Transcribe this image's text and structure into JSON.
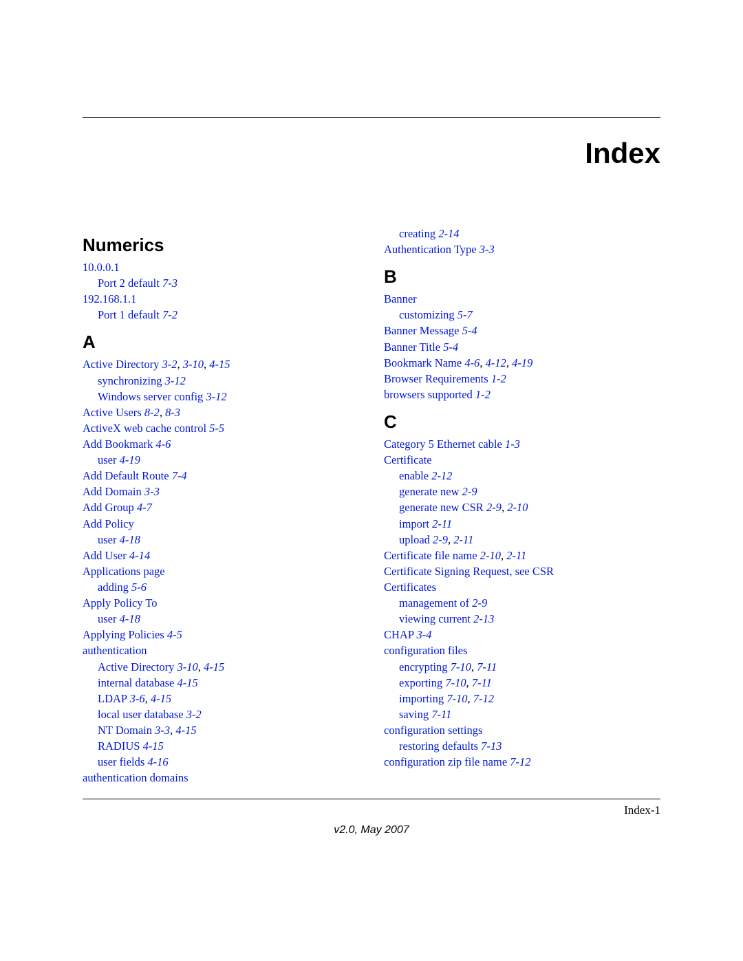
{
  "title": "Index",
  "page_number": "Index-1",
  "footer_version": "v2.0, May 2007",
  "left": {
    "sections": [
      {
        "heading": "Numerics",
        "items": [
          {
            "lvl": 1,
            "parts": [
              {
                "t": "10.0.0.1",
                "c": "link"
              }
            ]
          },
          {
            "lvl": 2,
            "parts": [
              {
                "t": "Port 2 default ",
                "c": "link"
              },
              {
                "t": "7-3",
                "c": "link ital"
              }
            ]
          },
          {
            "lvl": 1,
            "parts": [
              {
                "t": "192.168.1.1",
                "c": "link"
              }
            ]
          },
          {
            "lvl": 2,
            "parts": [
              {
                "t": "Port 1 default ",
                "c": "link"
              },
              {
                "t": "7-2",
                "c": "link ital"
              }
            ]
          }
        ]
      },
      {
        "heading": "A",
        "items": [
          {
            "lvl": 1,
            "parts": [
              {
                "t": "Active Directory ",
                "c": "link"
              },
              {
                "t": "3-2",
                "c": "link ital"
              },
              {
                "t": ", ",
                "c": "sep"
              },
              {
                "t": "3-10",
                "c": "link ital"
              },
              {
                "t": ", ",
                "c": "sep"
              },
              {
                "t": "4-15",
                "c": "link ital"
              }
            ]
          },
          {
            "lvl": 2,
            "parts": [
              {
                "t": "synchronizing ",
                "c": "link"
              },
              {
                "t": "3-12",
                "c": "link ital"
              }
            ]
          },
          {
            "lvl": 2,
            "parts": [
              {
                "t": "Windows server config ",
                "c": "link"
              },
              {
                "t": "3-12",
                "c": "link ital"
              }
            ]
          },
          {
            "lvl": 1,
            "parts": [
              {
                "t": "Active Users ",
                "c": "link"
              },
              {
                "t": "8-2",
                "c": "link ital"
              },
              {
                "t": ", ",
                "c": "sep"
              },
              {
                "t": "8-3",
                "c": "link ital"
              }
            ]
          },
          {
            "lvl": 1,
            "parts": [
              {
                "t": "ActiveX web cache control ",
                "c": "link"
              },
              {
                "t": "5-5",
                "c": "link ital"
              }
            ]
          },
          {
            "lvl": 1,
            "parts": [
              {
                "t": "Add Bookmark ",
                "c": "link"
              },
              {
                "t": "4-6",
                "c": "link ital"
              }
            ]
          },
          {
            "lvl": 2,
            "parts": [
              {
                "t": "user ",
                "c": "link"
              },
              {
                "t": "4-19",
                "c": "link ital"
              }
            ]
          },
          {
            "lvl": 1,
            "parts": [
              {
                "t": "Add Default Route ",
                "c": "link"
              },
              {
                "t": "7-4",
                "c": "link ital"
              }
            ]
          },
          {
            "lvl": 1,
            "parts": [
              {
                "t": "Add Domain ",
                "c": "link"
              },
              {
                "t": "3-3",
                "c": "link ital"
              }
            ]
          },
          {
            "lvl": 1,
            "parts": [
              {
                "t": "Add Group ",
                "c": "link"
              },
              {
                "t": "4-7",
                "c": "link ital"
              }
            ]
          },
          {
            "lvl": 1,
            "parts": [
              {
                "t": "Add Policy",
                "c": "link"
              }
            ]
          },
          {
            "lvl": 2,
            "parts": [
              {
                "t": "user ",
                "c": "link"
              },
              {
                "t": "4-18",
                "c": "link ital"
              }
            ]
          },
          {
            "lvl": 1,
            "parts": [
              {
                "t": "Add User ",
                "c": "link"
              },
              {
                "t": "4-14",
                "c": "link ital"
              }
            ]
          },
          {
            "lvl": 1,
            "parts": [
              {
                "t": "Applications page",
                "c": "link"
              }
            ]
          },
          {
            "lvl": 2,
            "parts": [
              {
                "t": "adding ",
                "c": "link"
              },
              {
                "t": "5-6",
                "c": "link ital"
              }
            ]
          },
          {
            "lvl": 1,
            "parts": [
              {
                "t": "Apply Policy To",
                "c": "link"
              }
            ]
          },
          {
            "lvl": 2,
            "parts": [
              {
                "t": "user ",
                "c": "link"
              },
              {
                "t": "4-18",
                "c": "link ital"
              }
            ]
          },
          {
            "lvl": 1,
            "parts": [
              {
                "t": "Applying Policies ",
                "c": "link"
              },
              {
                "t": "4-5",
                "c": "link ital"
              }
            ]
          },
          {
            "lvl": 1,
            "parts": [
              {
                "t": "authentication",
                "c": "link"
              }
            ]
          },
          {
            "lvl": 2,
            "parts": [
              {
                "t": "Active Directory ",
                "c": "link"
              },
              {
                "t": "3-10",
                "c": "link ital"
              },
              {
                "t": ", ",
                "c": "sep"
              },
              {
                "t": "4-15",
                "c": "link ital"
              }
            ]
          },
          {
            "lvl": 2,
            "parts": [
              {
                "t": "internal database ",
                "c": "link"
              },
              {
                "t": "4-15",
                "c": "link ital"
              }
            ]
          },
          {
            "lvl": 2,
            "parts": [
              {
                "t": "LDAP ",
                "c": "link"
              },
              {
                "t": "3-6",
                "c": "link ital"
              },
              {
                "t": ", ",
                "c": "sep"
              },
              {
                "t": "4-15",
                "c": "link ital"
              }
            ]
          },
          {
            "lvl": 2,
            "parts": [
              {
                "t": "local user database ",
                "c": "link"
              },
              {
                "t": "3-2",
                "c": "link ital"
              }
            ]
          },
          {
            "lvl": 2,
            "parts": [
              {
                "t": "NT Domain ",
                "c": "link"
              },
              {
                "t": "3-3",
                "c": "link ital"
              },
              {
                "t": ", ",
                "c": "sep"
              },
              {
                "t": "4-15",
                "c": "link ital"
              }
            ]
          },
          {
            "lvl": 2,
            "parts": [
              {
                "t": "RADIUS ",
                "c": "link"
              },
              {
                "t": "4-15",
                "c": "link ital"
              }
            ]
          },
          {
            "lvl": 2,
            "parts": [
              {
                "t": "user fields ",
                "c": "link"
              },
              {
                "t": "4-16",
                "c": "link ital"
              }
            ]
          },
          {
            "lvl": 1,
            "parts": [
              {
                "t": "authentication domains",
                "c": "link"
              }
            ]
          }
        ]
      }
    ]
  },
  "right": {
    "sections": [
      {
        "heading": "",
        "items": [
          {
            "lvl": 2,
            "parts": [
              {
                "t": "creating ",
                "c": "link"
              },
              {
                "t": "2-14",
                "c": "link ital"
              }
            ]
          },
          {
            "lvl": 1,
            "parts": [
              {
                "t": "Authentication Type ",
                "c": "link"
              },
              {
                "t": "3-3",
                "c": "link ital"
              }
            ]
          }
        ]
      },
      {
        "heading": "B",
        "items": [
          {
            "lvl": 1,
            "parts": [
              {
                "t": "Banner",
                "c": "link"
              }
            ]
          },
          {
            "lvl": 2,
            "parts": [
              {
                "t": "customizing ",
                "c": "link"
              },
              {
                "t": "5-7",
                "c": "link ital"
              }
            ]
          },
          {
            "lvl": 1,
            "parts": [
              {
                "t": "Banner Message ",
                "c": "link"
              },
              {
                "t": "5-4",
                "c": "link ital"
              }
            ]
          },
          {
            "lvl": 1,
            "parts": [
              {
                "t": "Banner Title ",
                "c": "link"
              },
              {
                "t": "5-4",
                "c": "link ital"
              }
            ]
          },
          {
            "lvl": 1,
            "parts": [
              {
                "t": "Bookmark Name ",
                "c": "link"
              },
              {
                "t": "4-6",
                "c": "link ital"
              },
              {
                "t": ", ",
                "c": "sep"
              },
              {
                "t": "4-12",
                "c": "link ital"
              },
              {
                "t": ", ",
                "c": "sep"
              },
              {
                "t": "4-19",
                "c": "link ital"
              }
            ]
          },
          {
            "lvl": 1,
            "parts": [
              {
                "t": "Browser Requirements ",
                "c": "link"
              },
              {
                "t": "1-2",
                "c": "link ital"
              }
            ]
          },
          {
            "lvl": 1,
            "parts": [
              {
                "t": "browsers supported ",
                "c": "link"
              },
              {
                "t": "1-2",
                "c": "link ital"
              }
            ]
          }
        ]
      },
      {
        "heading": "C",
        "items": [
          {
            "lvl": 1,
            "parts": [
              {
                "t": "Category 5 Ethernet cable ",
                "c": "link"
              },
              {
                "t": "1-3",
                "c": "link ital"
              }
            ]
          },
          {
            "lvl": 1,
            "parts": [
              {
                "t": "Certificate",
                "c": "link"
              }
            ]
          },
          {
            "lvl": 2,
            "parts": [
              {
                "t": "enable ",
                "c": "link"
              },
              {
                "t": "2-12",
                "c": "link ital"
              }
            ]
          },
          {
            "lvl": 2,
            "parts": [
              {
                "t": "generate new ",
                "c": "link"
              },
              {
                "t": "2-9",
                "c": "link ital"
              }
            ]
          },
          {
            "lvl": 2,
            "parts": [
              {
                "t": "generate new CSR ",
                "c": "link"
              },
              {
                "t": "2-9",
                "c": "link ital"
              },
              {
                "t": ", ",
                "c": "sep"
              },
              {
                "t": "2-10",
                "c": "link ital"
              }
            ]
          },
          {
            "lvl": 2,
            "parts": [
              {
                "t": "import ",
                "c": "link"
              },
              {
                "t": "2-11",
                "c": "link ital"
              }
            ]
          },
          {
            "lvl": 2,
            "parts": [
              {
                "t": "upload ",
                "c": "link"
              },
              {
                "t": "2-9",
                "c": "link ital"
              },
              {
                "t": ", ",
                "c": "sep"
              },
              {
                "t": "2-11",
                "c": "link ital"
              }
            ]
          },
          {
            "lvl": 1,
            "parts": [
              {
                "t": "Certificate file name ",
                "c": "link"
              },
              {
                "t": "2-10",
                "c": "link ital"
              },
              {
                "t": ", ",
                "c": "sep"
              },
              {
                "t": "2-11",
                "c": "link ital"
              }
            ]
          },
          {
            "lvl": 1,
            "parts": [
              {
                "t": "Certificate Signing Request, see CSR",
                "c": "link"
              }
            ]
          },
          {
            "lvl": 1,
            "parts": [
              {
                "t": "Certificates",
                "c": "link"
              }
            ]
          },
          {
            "lvl": 2,
            "parts": [
              {
                "t": "management of ",
                "c": "link"
              },
              {
                "t": "2-9",
                "c": "link ital"
              }
            ]
          },
          {
            "lvl": 2,
            "parts": [
              {
                "t": "viewing current ",
                "c": "link"
              },
              {
                "t": "2-13",
                "c": "link ital"
              }
            ]
          },
          {
            "lvl": 1,
            "parts": [
              {
                "t": "CHAP ",
                "c": "link"
              },
              {
                "t": "3-4",
                "c": "link ital"
              }
            ]
          },
          {
            "lvl": 1,
            "parts": [
              {
                "t": "configuration files",
                "c": "link"
              }
            ]
          },
          {
            "lvl": 2,
            "parts": [
              {
                "t": "encrypting ",
                "c": "link"
              },
              {
                "t": "7-10",
                "c": "link ital"
              },
              {
                "t": ", ",
                "c": "sep"
              },
              {
                "t": "7-11",
                "c": "link ital"
              }
            ]
          },
          {
            "lvl": 2,
            "parts": [
              {
                "t": "exporting ",
                "c": "link"
              },
              {
                "t": "7-10",
                "c": "link ital"
              },
              {
                "t": ", ",
                "c": "sep"
              },
              {
                "t": "7-11",
                "c": "link ital"
              }
            ]
          },
          {
            "lvl": 2,
            "parts": [
              {
                "t": "importing ",
                "c": "link"
              },
              {
                "t": "7-10",
                "c": "link ital"
              },
              {
                "t": ", ",
                "c": "sep"
              },
              {
                "t": "7-12",
                "c": "link ital"
              }
            ]
          },
          {
            "lvl": 2,
            "parts": [
              {
                "t": "saving ",
                "c": "link"
              },
              {
                "t": "7-11",
                "c": "link ital"
              }
            ]
          },
          {
            "lvl": 1,
            "parts": [
              {
                "t": "configuration settings",
                "c": "link"
              }
            ]
          },
          {
            "lvl": 2,
            "parts": [
              {
                "t": "restoring defaults ",
                "c": "link"
              },
              {
                "t": "7-13",
                "c": "link ital"
              }
            ]
          },
          {
            "lvl": 1,
            "parts": [
              {
                "t": "configuration zip file name ",
                "c": "link"
              },
              {
                "t": "7-12",
                "c": "link ital"
              }
            ]
          }
        ]
      }
    ]
  }
}
